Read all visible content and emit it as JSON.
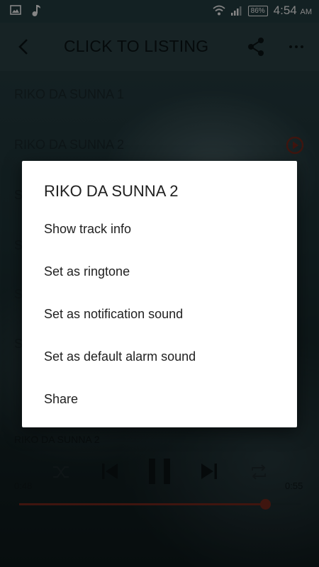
{
  "status_bar": {
    "battery": "86%",
    "time": "4:54",
    "ampm": "AM"
  },
  "app_bar": {
    "title": "CLICK TO LISTING"
  },
  "tracks": [
    {
      "label": "RIKO DA SUNNA 1"
    },
    {
      "label": "RIKO DA SUNNA 2"
    },
    {
      "label": "S"
    },
    {
      "label": "S"
    },
    {
      "label": "S"
    },
    {
      "label": "S"
    }
  ],
  "player": {
    "now_playing": "RIKO DA SUNNA 2",
    "elapsed": "0:48",
    "duration": "0:55",
    "progress_fraction": 0.873,
    "accent_color": "#7a2a1e",
    "icons": [
      "shuffle-icon",
      "previous-icon",
      "pause-icon",
      "next-icon",
      "repeat-icon"
    ]
  },
  "dialog": {
    "title": "RIKO DA SUNNA 2",
    "items": [
      {
        "label": "Show track info"
      },
      {
        "label": "Set as ringtone"
      },
      {
        "label": "Set as notification sound"
      },
      {
        "label": "Set as default alarm sound"
      },
      {
        "label": "Share"
      }
    ]
  }
}
